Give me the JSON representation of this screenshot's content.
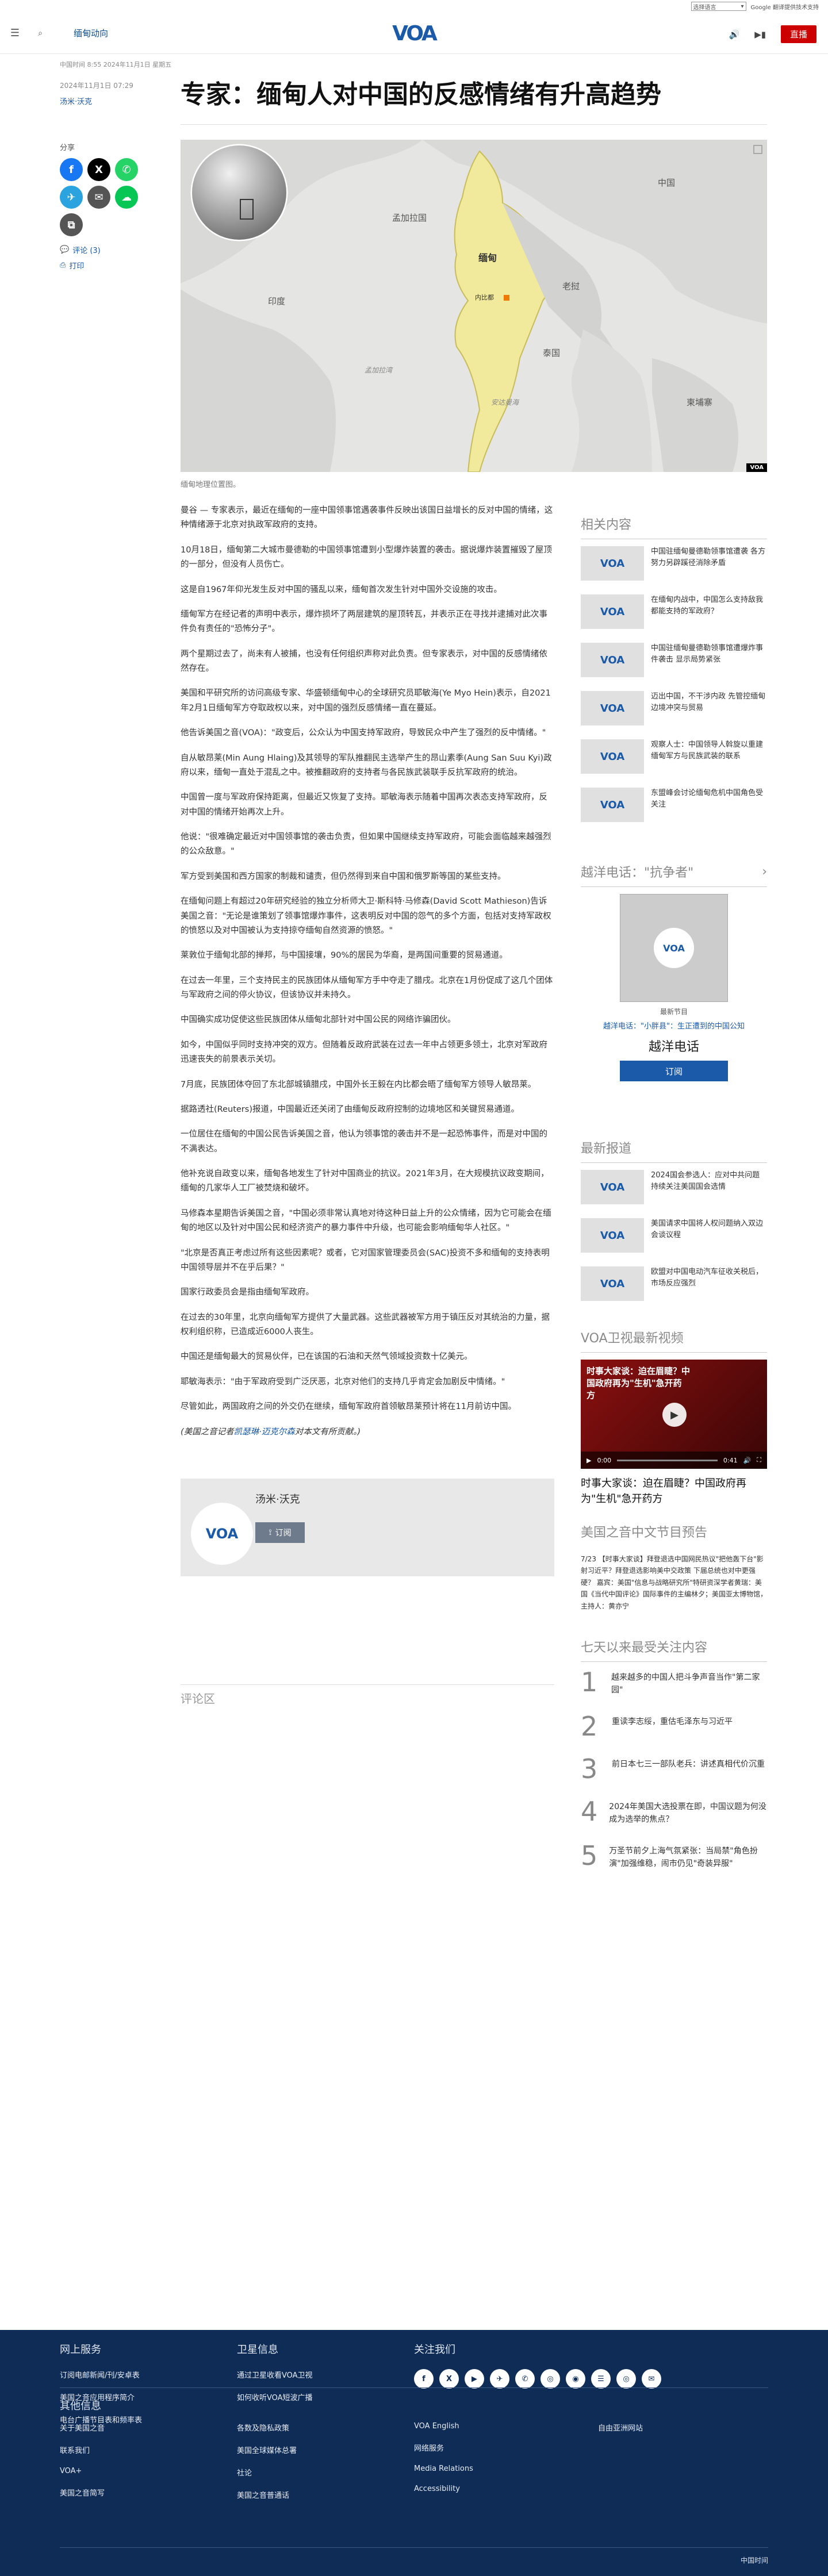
{
  "lang_bar": {
    "select_label": "选择语言",
    "translate_label": "Google 翻译提供技术支持"
  },
  "header": {
    "section": "缅甸动向",
    "logo": "VOA",
    "live_label": "直播"
  },
  "meta": {
    "dateline": "中国时间 8:55 2024年11月1日 星期五",
    "published": "2024年11月1日 07:29",
    "byline": "汤米·沃克"
  },
  "article_title": "专家：缅甸人对中国的反感情绪有升高趋势",
  "share": {
    "label": "分享",
    "comments": "评论 (3)",
    "print": "打印"
  },
  "map": {
    "labels": [
      "中国",
      "孟加拉国",
      "缅甸",
      "内比都",
      "老挝",
      "印度",
      "泰国",
      "柬埔寨",
      "孟加拉湾",
      "安达曼海"
    ],
    "credit": "VOA",
    "caption": "缅甸地理位置图。"
  },
  "article": {
    "paragraphs": [
      "曼谷 — 专家表示，最近在缅甸的一座中国领事馆遇袭事件反映出该国日益增长的反对中国的情绪，这种情绪源于北京对执政军政府的支持。",
      "10月18日，缅甸第二大城市曼德勒的中国领事馆遭到小型爆炸装置的袭击。据说爆炸装置摧毁了屋顶的一部分，但没有人员伤亡。",
      "这是自1967年仰光发生反对中国的骚乱以来，缅甸首次发生针对中国外交设施的攻击。",
      "缅甸军方在经记者的声明中表示，爆炸损坏了两层建筑的屋顶转瓦，并表示正在寻找并逮捕对此次事件负有责任的\"恐怖分子\"。",
      "两个星期过去了，尚未有人被捕，也没有任何组织声称对此负责。但专家表示，对中国的反感情绪依然存在。",
      "美国和平研究所的访问高级专家、华盛顿缅甸中心的全球研究员耶敏海(Ye Myo Hein)表示，自2021年2月1日缅甸军方夺取政权以来，对中国的强烈反感情绪一直在蔓延。",
      "他告诉美国之音(VOA)：\"政变后，公众认为中国支持军政府，导致民众中产生了强烈的反中情绪。\"",
      "自从敏昂莱(Min Aung Hlaing)及其领导的军队推翻民主选举产生的昂山素季(Aung San Suu Kyi)政府以来，缅甸一直处于混乱之中。被推翻政府的支持者与各民族武装联手反抗军政府的统治。",
      "中国曾一度与军政府保持距离，但最近又恢复了支持。耶敏海表示随着中国再次表态支持军政府，反对中国的情绪开始再次上升。",
      "他说：\"很难确定最近对中国领事馆的袭击负责，但如果中国继续支持军政府，可能会面临越来越强烈的公众敌意。\"",
      "军方受到美国和西方国家的制裁和谴责，但仍然得到来自中国和俄罗斯等国的某些支持。",
      "在缅甸问题上有超过20年研究经验的独立分析师大卫·斯科特·马修森(David Scott Mathieson)告诉美国之音：\"无论是谁策划了领事馆爆炸事件，这表明反对中国的怨气的多个方面，包括对支持军政权的愤怒以及对中国被认为支持掠夺缅甸自然资源的愤怒。\"",
      "莱敦位于缅甸北部的掸邦，与中国接壤，90%的居民为华裔，是两国间重要的贸易通道。",
      "在过去一年里，三个支持民主的民族团体从缅甸军方手中夺走了腊戌。北京在1月份促成了这几个团体与军政府之间的停火协议，但该协议并未持久。",
      "中国确实成功促使这些民族团体从缅甸北部针对中国公民的网络诈骗团伙。",
      "如今，中国似乎同时支持冲突的双方。但随着反政府武装在过去一年中占领更多领土，北京对军政府迅速丧失的前景表示关切。",
      "7月底，民族团体夺回了东北部城镇腊戌，中国外长王毅在内比都会晤了缅甸军方领导人敏昂莱。",
      "据路透社(Reuters)报道，中国最近还关闭了由缅甸反政府控制的边境地区和关键贸易通道。",
      "一位居住在缅甸的中国公民告诉美国之音，他认为领事馆的袭击并不是一起恐怖事件，而是对中国的不满表达。",
      "他补充说自政变以来，缅甸各地发生了针对中国商业的抗议。2021年3月，在大规模抗议政变期间，缅甸的几家华人工厂被焚烧和破坏。",
      "马修森本星期告诉美国之音，\"中国必须非常认真地对待这种日益上升的公众情绪，因为它可能会在缅甸的地区以及针对中国公民和经济资产的暴力事件中升级，也可能会影响缅甸华人社区。\"",
      "\"北京是否真正考虑过所有这些因素呢？或者，它对国家管理委员会(SAC)投资不多和缅甸的支持表明中国领导层并不在乎后果？\"",
      "国家行政委员会是指由缅甸军政府。",
      "在过去的30年里，北京向缅甸军方提供了大量武器。这些武器被军方用于镇压反对其统治的力量，据权利组织称，已造成近6000人丧生。",
      "中国还是缅甸最大的贸易伙伴，已在该国的石油和天然气领域投资数十亿美元。",
      "耶敏海表示：\"由于军政府受到广泛厌恶，北京对他们的支持几乎肯定会加剧反中情绪。\"",
      "尽管如此，两国政府之间的外交仍在继续，缅甸军政府首领敏昂莱预计将在11月前访中国。"
    ],
    "credit_prefix": "(美国之音记者",
    "credit_link": "凯瑟琳·迈克尔森",
    "credit_suffix": "对本文有所贡献。)"
  },
  "author_box": {
    "name": "汤米·沃克",
    "subscribe": "订阅"
  },
  "comments_heading": "评论区",
  "rail": {
    "related_title": "相关内容",
    "related": [
      "中国驻缅甸曼德勒领事馆遭袭 各方努力另辟蹊径消除矛盾",
      "在缅甸内战中，中国怎么支持敌我都能支持的军政府？",
      "中国驻缅甸曼德勒领事馆遭爆炸事件袭击 显示局势紧张",
      "迈出中国，不干涉内政 先管控缅甸边境冲突与贸易",
      "观察人士：中国领导人斡旋以重建缅甸军方与民族武装的联系",
      "东盟峰会讨论缅甸危机中国角色受关注"
    ],
    "podcast_title": "越洋电话：\"抗争者\"",
    "podcast_label": "最新节目",
    "podcast_link": "越洋电话：\"小胖县\"：生正遭到的中国公知",
    "podcast_name": "越洋电话",
    "podcast_subscribe": "订阅",
    "latest_title": "最新报道",
    "latest": [
      "2024国会参选人：应对中共问题持续关注美国国会选情",
      "美国请求中国将人权问题纳入双边会谈议程",
      "欧盟对中国电动汽车征收关税后，市场反应强烈"
    ],
    "video_title": "VOA卫视最新视频",
    "video_overlay": "时事大家谈：迫在眉睫？中国政府再为\"生机\"急开药方",
    "video_time": "0:00",
    "video_total": "0:41",
    "video_headline": "时事大家谈：迫在眉睫？中国政府再为\"生机\"急开药方",
    "schedule_title": "美国之音中文节目预告",
    "schedule_text": "7/23 【时事大家谈】拜登退选中国网民热议\"把他轰下台\"影射习近平？拜登退选影响美中交政策 下届总统也对中更强硬？ 嘉宾：美国\"信息与战略研究所\"特研资深学者黄瑞：美国《当代中国评论》国际事件的主编林夕；美国亚太博物馆，主持人：黄亦宁",
    "popular_title": "七天以来最受关注内容",
    "popular": [
      "越来越多的中国人把斗争声音当作\"第二家园\"",
      "重读李志绥，重估毛泽东与习近平",
      "前日本七三一部队老兵：讲述真相代价沉重",
      "2024年美国大选投票在即，中国议题为何没成为选举的焦点？",
      "万圣节前夕上海气氛紧张：当局禁\"角色扮演\"加强维稳，闹市仍见\"奇装异服\""
    ]
  },
  "footer": {
    "sections": [
      {
        "title": "网上服务",
        "links": [
          "订阅电邮新闻/刊/安卓表",
          "美国之音应用程序简介",
          "电台广播节目表和频率表"
        ]
      },
      {
        "title": "卫星信息",
        "links": [
          "通过卫星收看VOA卫视",
          "如何收听VOA短波广播"
        ]
      },
      {
        "title": "关注我们",
        "links": []
      }
    ],
    "social": [
      "f",
      "X",
      "▶",
      "✈",
      "✆",
      "◎",
      "◉",
      "☰",
      "◎",
      "✉"
    ],
    "other_title": "其他信息",
    "other_cols": [
      [
        "关于美国之音",
        "联系我们",
        "VOA+",
        "美国之音简写"
      ],
      [
        "各数及隐私政策",
        "美国全球媒体总署",
        "社论",
        "美国之音普通话"
      ],
      [
        "VOA English",
        "网络服务",
        "Media Relations",
        "Accessibility"
      ],
      [
        "自由亚洲网站"
      ]
    ],
    "language_select": "中国时间"
  }
}
